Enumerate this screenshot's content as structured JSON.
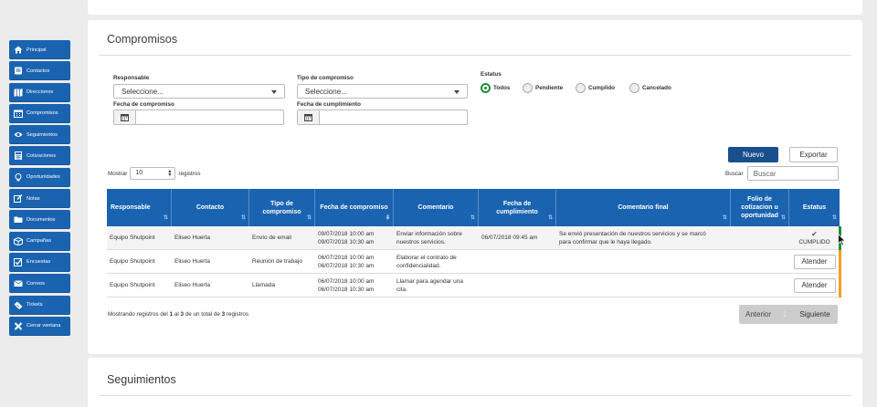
{
  "sidebar": {
    "items": [
      {
        "label": "Principal",
        "icon": "home-icon"
      },
      {
        "label": "Contactos",
        "icon": "contacts-icon"
      },
      {
        "label": "Direcciones",
        "icon": "map-icon"
      },
      {
        "label": "Compromisos",
        "icon": "calendar-icon"
      },
      {
        "label": "Seguimientos",
        "icon": "eye-icon"
      },
      {
        "label": "Cotizaciones",
        "icon": "calculator-icon"
      },
      {
        "label": "Oportunidades",
        "icon": "lightbulb-icon"
      },
      {
        "label": "Notas",
        "icon": "edit-icon"
      },
      {
        "label": "Documentos",
        "icon": "folder-icon"
      },
      {
        "label": "Campañas",
        "icon": "box-icon"
      },
      {
        "label": "Encuestas",
        "icon": "checkbox-icon"
      },
      {
        "label": "Correos",
        "icon": "email-icon"
      },
      {
        "label": "Tickets",
        "icon": "ticket-icon"
      },
      {
        "label": "Cerrar ventana",
        "icon": "close-icon"
      }
    ]
  },
  "main": {
    "title": "Compromisos",
    "filters": {
      "responsable_label": "Responsable",
      "responsable_value": "Seleccione...",
      "tipo_label": "Tipo de compromiso",
      "tipo_value": "Seleccione...",
      "estatus_label": "Estatus",
      "fecha_compromiso_label": "Fecha de compromiso",
      "fecha_cumplimiento_label": "Fecha de cumplimiento",
      "radios": [
        {
          "label": "Todos",
          "selected": true
        },
        {
          "label": "Pendiente",
          "selected": false
        },
        {
          "label": "Cumplido",
          "selected": false
        },
        {
          "label": "Cancelado",
          "selected": false
        }
      ]
    },
    "buttons": {
      "nuevo": "Nuevo",
      "exportar": "Exportar"
    },
    "mostrar": {
      "prefix": "Mostrar",
      "value": "10",
      "suffix": "registros"
    },
    "buscar": {
      "label": "Buscar",
      "placeholder": "Buscar"
    },
    "table": {
      "headers": [
        "Responsable",
        "Contacto",
        "Tipo de compromiso",
        "Fecha de compromiso",
        "Comentario",
        "Fecha de cumplimiento",
        "Comentario final",
        "Folio de cotizacion u oportunidad",
        "Estatus"
      ],
      "rows": [
        {
          "responsable": "Equipo Shutpoint",
          "contacto": "Eliseo Huerta",
          "tipo": "Envío de email",
          "fecha1": "09/07/2018 10:00 am",
          "fecha2": "09/07/2018 10:30 am",
          "comentario1": "Enviar información sobre",
          "comentario2": "nuestros servicios.",
          "fecha_cumplimiento": "06/07/2018 09:45 am",
          "comentario_final1": "Se envió presentación de nuestros servicios y se marcó",
          "comentario_final2": "para confirmar que le haya llegado.",
          "folio": "",
          "estatus": "CUMPLIDO",
          "bar_color": "#1f8f3a"
        },
        {
          "responsable": "Equipo Shutpoint",
          "contacto": "Eliseo Huerta",
          "tipo": "Reunión de trabajo",
          "fecha1": "06/07/2018 10:00 am",
          "fecha2": "06/07/2018 10:30 am",
          "comentario1": "Elaborar el contrato de",
          "comentario2": "confidencialidad.",
          "fecha_cumplimiento": "",
          "comentario_final1": "",
          "comentario_final2": "",
          "folio": "",
          "estatus": "Atender",
          "bar_color": "#f0a020"
        },
        {
          "responsable": "Equipo Shutpoint",
          "contacto": "Eliseo Huerta",
          "tipo": "Llamada",
          "fecha1": "06/07/2018 10:00 am",
          "fecha2": "06/07/2018 10:30 am",
          "comentario1": "Llamar para agendar una",
          "comentario2": "cita.",
          "fecha_cumplimiento": "",
          "comentario_final1": "",
          "comentario_final2": "",
          "folio": "",
          "estatus": "Atender",
          "bar_color": "#f0a020"
        }
      ]
    },
    "info": {
      "a": "Mostrando registros del ",
      "from": "1",
      "b": " al ",
      "to": "3",
      "c": " de un total de ",
      "total": "3",
      "d": " registros"
    },
    "pager": {
      "prev": "Anterior",
      "page": "1",
      "next": "Siguiente"
    }
  },
  "second_card": {
    "title": "Seguimientos"
  },
  "colors": {
    "sidebar": "#1a63b0",
    "table_header": "#1a63b0",
    "primary_button": "#1a4f8e",
    "selected_radio": "#1f8f3a",
    "cumplido_bar": "#1f8f3a",
    "pending_bar": "#f0a020"
  }
}
